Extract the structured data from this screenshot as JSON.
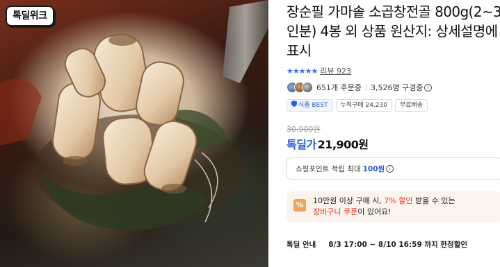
{
  "brand": {
    "logo_text": "톡딜위크"
  },
  "product": {
    "title": "장순필 가마솥 소곱창전골 800g(2~3인분) 4봉 외 상품 원산지: 상세설명에 표시",
    "rating_stars": "★★★★★",
    "review_link": "리뷰 923",
    "orders": "651개 주문중",
    "considering": "3,526명 구경중",
    "info_glyph": "i"
  },
  "badges": [
    {
      "label": "식품 BEST",
      "icon": "shield-icon"
    },
    {
      "label": "누적구매 24,230"
    },
    {
      "label": "무료배송"
    }
  ],
  "price": {
    "original": "30,900원",
    "sale_label": "톡딜가",
    "sale": "21,900원"
  },
  "points": {
    "prefix": "쇼핑포인트 적립 최대",
    "amount": "100원"
  },
  "coupon": {
    "icon_text": "%",
    "line1_a": "10만원 이상 구매 시, ",
    "line1_pct": "7% 할인",
    "line1_b": " 받을 수 있는",
    "line2_red": "장바구니 쿠폰",
    "line2_b": "이 있어요!"
  },
  "deal": {
    "label": "톡딜 안내",
    "period": "8/3 17:00 ~ 8/10 16:59 까지 한정할인"
  },
  "colors": {
    "accent": "#2b5fd9",
    "sale_red": "#e0392b",
    "coupon_bg": "#fbf4ec",
    "coupon_icon": "#f0a35a"
  }
}
